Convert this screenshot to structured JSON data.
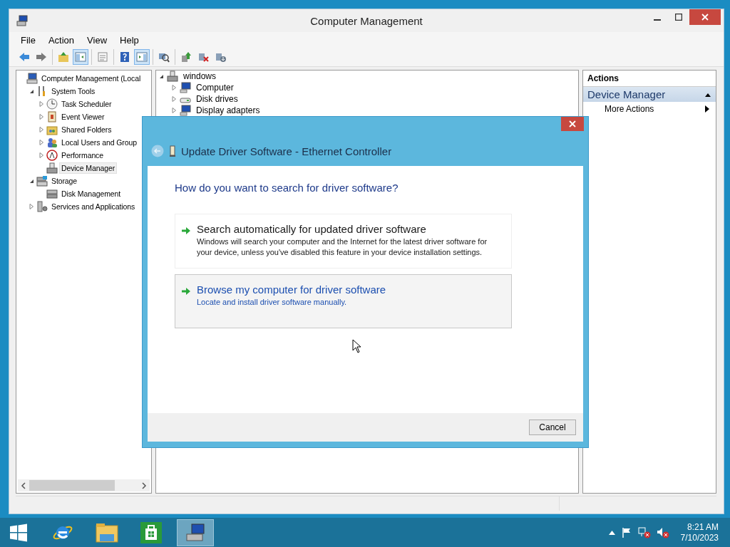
{
  "window": {
    "title": "Computer Management"
  },
  "menu": [
    "File",
    "Action",
    "View",
    "Help"
  ],
  "toolbar": [
    [
      {
        "kind": "back",
        "pressed": false
      },
      {
        "kind": "forward",
        "pressed": false
      }
    ],
    [
      {
        "kind": "up",
        "pressed": false
      },
      {
        "kind": "tree",
        "pressed": true
      }
    ],
    [
      {
        "kind": "properties",
        "pressed": false
      }
    ],
    [
      {
        "kind": "help",
        "pressed": false
      },
      {
        "kind": "pane",
        "pressed": true
      }
    ],
    [
      {
        "kind": "scan",
        "pressed": false
      }
    ],
    [
      {
        "kind": "update",
        "pressed": false
      },
      {
        "kind": "disable",
        "pressed": false
      },
      {
        "kind": "uninstall",
        "pressed": false
      }
    ]
  ],
  "navigation_tree": [
    {
      "label": "Computer Management (Local",
      "kind": "computer",
      "selected": false,
      "children": [
        {
          "label": "System Tools",
          "kind": "tools",
          "expanded": true,
          "selected": false,
          "children": [
            {
              "label": "Task Scheduler",
              "kind": "clock",
              "expanded": false,
              "selected": false
            },
            {
              "label": "Event Viewer",
              "kind": "log",
              "expanded": false,
              "selected": false
            },
            {
              "label": "Shared Folders",
              "kind": "folder",
              "expanded": false,
              "selected": false
            },
            {
              "label": "Local Users and Group",
              "kind": "users",
              "expanded": false,
              "selected": false
            },
            {
              "label": "Performance",
              "kind": "gauge",
              "expanded": false,
              "selected": false
            },
            {
              "label": "Device Manager",
              "kind": "device",
              "selected": true
            }
          ]
        },
        {
          "label": "Storage",
          "kind": "storage",
          "expanded": true,
          "selected": false,
          "children": [
            {
              "label": "Disk Management",
              "kind": "disk",
              "selected": false
            }
          ]
        },
        {
          "label": "Services and Applications",
          "kind": "services",
          "expanded": false,
          "selected": false
        }
      ]
    }
  ],
  "device_tree": [
    {
      "label": "windows",
      "kind": "device",
      "expanded": true,
      "children": [
        {
          "label": "Computer",
          "kind": "monitor",
          "expanded": false
        },
        {
          "label": "Disk drives",
          "kind": "drive",
          "expanded": false
        },
        {
          "label": "Display adapters",
          "kind": "monitor",
          "expanded": false
        }
      ]
    }
  ],
  "actions": {
    "header": "Actions",
    "section": {
      "label": "Device Manager",
      "expanded": true
    },
    "items": [
      {
        "label": "More Actions"
      }
    ]
  },
  "dialog": {
    "title": "Update Driver Software - Ethernet Controller",
    "heading": "How do you want to search for driver software?",
    "options": [
      {
        "title": "Search automatically for updated driver software",
        "description": "Windows will search your computer and the Internet for the latest driver software for your device, unless you've disabled this feature in your device installation settings.",
        "highlighted": false
      },
      {
        "title": "Browse my computer for driver software",
        "description": "Locate and install driver software manually.",
        "highlighted": true
      }
    ],
    "buttons": [
      "Cancel"
    ]
  },
  "taskbar": {
    "apps": [
      {
        "kind": "start",
        "selected": false
      },
      {
        "kind": "browser",
        "selected": false
      },
      {
        "kind": "explorer",
        "selected": false
      },
      {
        "kind": "store",
        "selected": false
      },
      {
        "kind": "management",
        "selected": true
      }
    ],
    "time": "8:21 AM",
    "date": "7/10/2023"
  }
}
